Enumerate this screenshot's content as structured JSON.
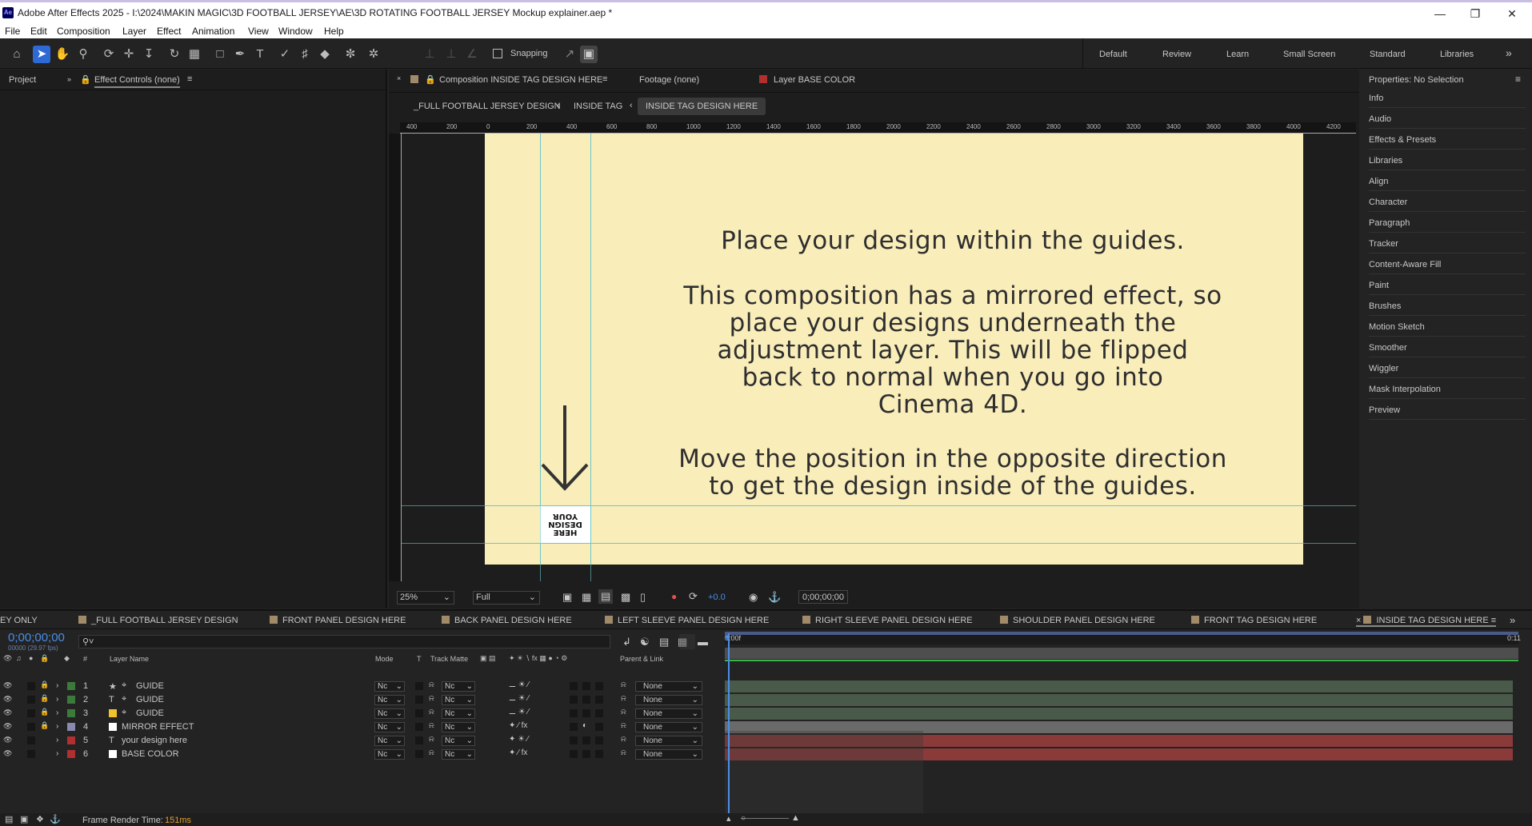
{
  "window": {
    "app_icon": "Ae",
    "title": "Adobe After Effects 2025 - I:\\2024\\MAKIN MAGIC\\3D FOOTBALL JERSEY\\AE\\3D ROTATING FOOTBALL JERSEY Mockup explainer.aep *",
    "controls": [
      "minimize-icon",
      "restore-icon",
      "close-icon"
    ]
  },
  "menu": [
    "File",
    "Edit",
    "Composition",
    "Layer",
    "Effect",
    "Animation",
    "View",
    "Window",
    "Help"
  ],
  "toolbar": {
    "snapping_label": "Snapping",
    "workspaces": [
      "Default",
      "Review",
      "Learn",
      "Small Screen",
      "Standard",
      "Libraries"
    ]
  },
  "left_panel": {
    "tabs": [
      "Project",
      "Effect Controls (none)"
    ]
  },
  "comp_panel": {
    "tab_composition": "Composition INSIDE TAG DESIGN HERE",
    "tab_footage": "Footage (none)",
    "tab_layer": "Layer BASE COLOR",
    "breadcrumbs": [
      "_FULL FOOTBALL JERSEY DESIGN",
      "INSIDE TAG",
      "INSIDE TAG DESIGN HERE"
    ],
    "ruler_labels": [
      "400",
      "200",
      "0",
      "200",
      "400",
      "600",
      "800",
      "1000",
      "1200",
      "1400",
      "1600",
      "1800",
      "2000",
      "2200",
      "2400",
      "2600",
      "2800",
      "3000",
      "3200",
      "3400",
      "3600",
      "3800",
      "4000",
      "4200"
    ],
    "canvas": {
      "line1": "Place your design within the guides.",
      "paragraph2": [
        "This composition has a mirrored effect, so",
        "place your designs underneath the",
        "adjustment layer. This will be flipped",
        "back to normal when you go into",
        "Cinema 4D."
      ],
      "paragraph3": [
        "Move the position in the opposite direction",
        "to get the design inside of the guides."
      ],
      "mirrored_box": [
        "YOUR",
        "DESIGN",
        "HERE"
      ],
      "background_color": "#f9edba"
    },
    "footer": {
      "zoom": "25%",
      "resolution": "Full",
      "exposure": "+0.0",
      "timecode": "0;00;00;00"
    }
  },
  "right_panel": {
    "title": "Properties: No Selection",
    "items": [
      "Info",
      "Audio",
      "Effects & Presets",
      "Libraries",
      "Align",
      "Character",
      "Paragraph",
      "Tracker",
      "Content-Aware Fill",
      "Paint",
      "Brushes",
      "Motion Sketch",
      "Smoother",
      "Wiggler",
      "Mask Interpolation",
      "Preview"
    ]
  },
  "timeline": {
    "tabs": [
      {
        "label": "EY ONLY",
        "color": ""
      },
      {
        "label": "_FULL FOOTBALL JERSEY DESIGN",
        "color": "#a08a6a"
      },
      {
        "label": "FRONT PANEL DESIGN HERE",
        "color": "#a08a6a"
      },
      {
        "label": "BACK PANEL DESIGN HERE",
        "color": "#a08a6a"
      },
      {
        "label": "LEFT SLEEVE PANEL DESIGN HERE",
        "color": "#a08a6a"
      },
      {
        "label": "RIGHT SLEEVE PANEL DESIGN HERE",
        "color": "#a08a6a"
      },
      {
        "label": "SHOULDER PANEL DESIGN HERE",
        "color": "#a08a6a"
      },
      {
        "label": "FRONT TAG DESIGN HERE",
        "color": "#a08a6a"
      },
      {
        "label": "INSIDE TAG DESIGN HERE",
        "color": "#a08a6a"
      }
    ],
    "timecode": "0;00;00;00",
    "fps": "00000 (29.97 fps)",
    "columns": {
      "layer_name": "Layer Name",
      "mode": "Mode",
      "t": "T",
      "track_matte": "Track Matte",
      "parent_link": "Parent & Link",
      "hash": "#"
    },
    "ruler_start": "0:00f",
    "ruler_end": "0:11",
    "layers": [
      {
        "num": "1",
        "type_icon": "★",
        "name": "GUIDE",
        "label_color": "#3c7a3c",
        "swatch": "",
        "mode": "Nc",
        "matte": "Nc",
        "parent": "None",
        "bar_color": "#4a5a4a"
      },
      {
        "num": "2",
        "type_icon": "T",
        "name": "GUIDE",
        "label_color": "#3c7a3c",
        "swatch": "",
        "mode": "Nc",
        "matte": "Nc",
        "parent": "None",
        "bar_color": "#4a5a4a"
      },
      {
        "num": "3",
        "type_icon": "",
        "name": "GUIDE",
        "label_color": "#3c7a3c",
        "swatch": "#f2c12e",
        "mode": "Nc",
        "matte": "Nc",
        "parent": "None",
        "bar_color": "#4a5a4a"
      },
      {
        "num": "4",
        "type_icon": "",
        "name": "MIRROR EFFECT",
        "label_color": "#8a8ab0",
        "swatch": "#ffffff",
        "mode": "Nc",
        "matte": "Nc",
        "parent": "None",
        "bar_color": "#6a6a6a"
      },
      {
        "num": "5",
        "type_icon": "T",
        "name": "your design here",
        "label_color": "#b03030",
        "swatch": "",
        "mode": "Nc",
        "matte": "Nc",
        "parent": "None",
        "bar_color": "#8b3a3a"
      },
      {
        "num": "6",
        "type_icon": "",
        "name": "BASE COLOR",
        "label_color": "#b03030",
        "swatch": "#ffffff",
        "mode": "Nc",
        "matte": "Nc",
        "parent": "None",
        "bar_color": "#8b3a3a"
      }
    ],
    "footer": {
      "render_label": "Frame Render Time:",
      "render_value": "151ms"
    }
  }
}
